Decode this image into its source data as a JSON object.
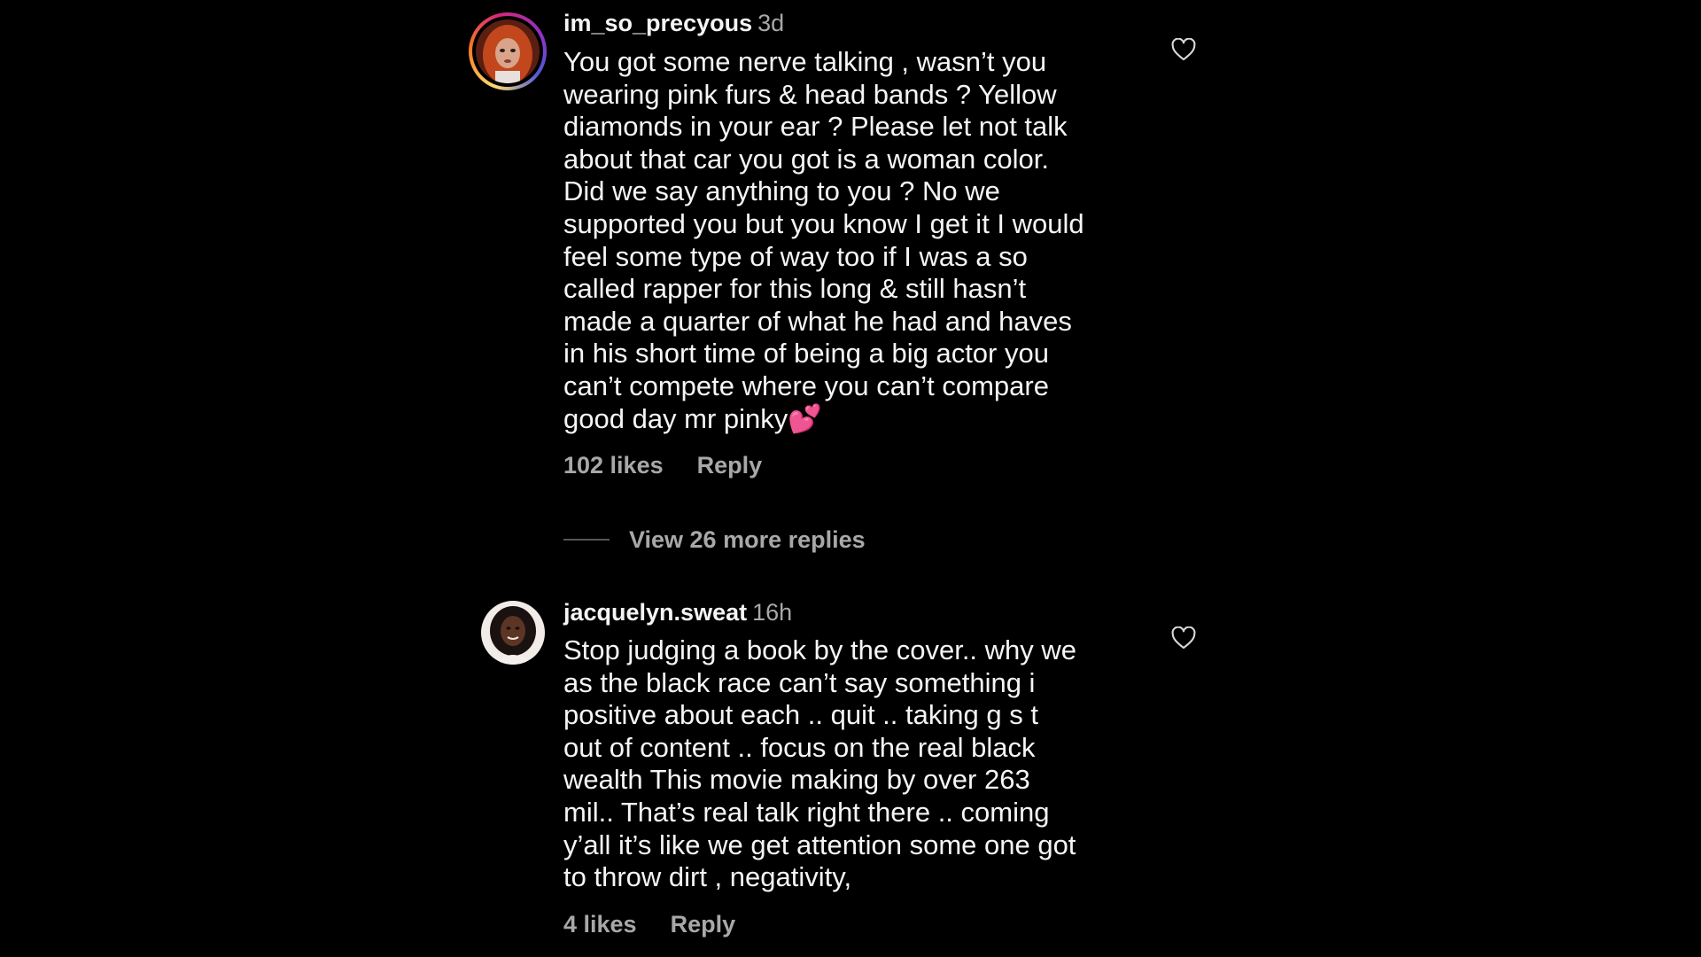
{
  "comments": [
    {
      "username": "im_so_precyous",
      "time": "3d",
      "text": "You got some nerve talking , wasn’t you\nwearing pink furs & head bands ? Yellow\ndiamonds in your ear ? Please let not talk\nabout that car you got is a woman color.\nDid we say anything to you ? No we\nsupported you but you know I get it I would\nfeel some type of way too if I was a so\ncalled rapper for this long & still hasn’t\nmade a quarter of what he had and haves\nin his short time of being a big actor you\ncan’t compete where you can’t compare\ngood day mr pinky💕",
      "likes": "102 likes",
      "reply_label": "Reply",
      "like_icon": "heart-outline-icon",
      "has_story_ring": true
    },
    {
      "username": "jacquelyn.sweat",
      "time": "16h",
      "text": "Stop judging a book by the cover.. why we\nas the black race can’t say something i\npositive about each .. quit .. taking g s  t\nout of content .. focus on the real  black\nwealth  This movie making by over 263\nmil.. That’s real talk right there .. coming\ny’all it’s like we get attention some one got\nto throw dirt , negativity,",
      "likes": "4 likes",
      "reply_label": "Reply",
      "like_icon": "heart-outline-icon",
      "has_story_ring": false
    }
  ],
  "view_replies": {
    "label": "View 26 more replies"
  },
  "colors": {
    "background": "#000000",
    "primary_text": "#f5f5f5",
    "secondary_text": "#a8a8a8",
    "story_ring_start": "#feda75",
    "story_ring_mid": "#d62976",
    "story_ring_end": "#962fbf"
  }
}
